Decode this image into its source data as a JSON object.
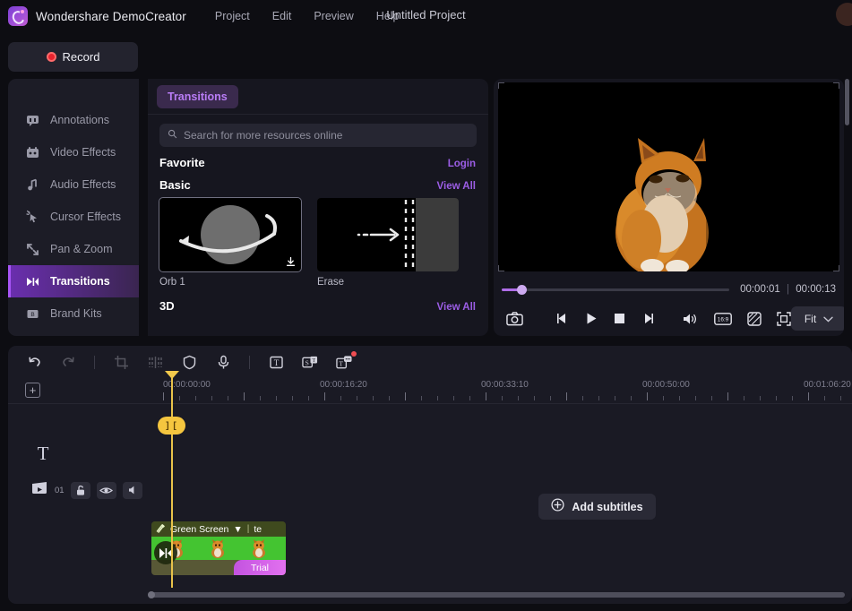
{
  "app": {
    "brand": "Wondershare DemoCreator",
    "project_title": "Untitled Project",
    "menu": [
      "Project",
      "Edit",
      "Preview",
      "Help"
    ],
    "accent": "#a855f7",
    "record_label": "Record"
  },
  "sidebar": {
    "items": [
      {
        "label": "Annotations",
        "icon": "annotations-icon"
      },
      {
        "label": "Video Effects",
        "icon": "video-effects-icon"
      },
      {
        "label": "Audio Effects",
        "icon": "audio-effects-icon"
      },
      {
        "label": "Cursor Effects",
        "icon": "cursor-effects-icon"
      },
      {
        "label": "Pan & Zoom",
        "icon": "pan-zoom-icon"
      },
      {
        "label": "Transitions",
        "icon": "transitions-icon"
      },
      {
        "label": "Brand Kits",
        "icon": "brand-kits-icon"
      }
    ],
    "active": "Transitions"
  },
  "resource_panel": {
    "tab": "Transitions",
    "search_placeholder": "Search for more resources online",
    "sections": [
      {
        "title": "Favorite",
        "link": "Login"
      },
      {
        "title": "Basic",
        "link": "View All"
      },
      {
        "title": "3D",
        "link": "View All"
      }
    ],
    "items": [
      {
        "name": "Orb 1",
        "thumb": "orb-transition-thumb",
        "downloadable": true
      },
      {
        "name": "Erase",
        "thumb": "erase-transition-thumb",
        "downloadable": false
      }
    ]
  },
  "preview": {
    "current_time": "00:00:01",
    "total_time": "00:00:13",
    "separator": "|",
    "progress_percent": 8,
    "fit_label": "Fit",
    "controls": [
      "snapshot-icon",
      "prev-frame-icon",
      "play-icon",
      "stop-icon",
      "next-frame-icon",
      "volume-icon",
      "aspect-ratio-icon",
      "render-icon",
      "fullscreen-icon"
    ],
    "aspect_ratio_label": "16:9"
  },
  "timeline": {
    "toolbar_icons": [
      "undo-icon",
      "redo-icon",
      "crop-icon",
      "split-icon",
      "mask-icon",
      "voiceover-icon",
      "text-icon",
      "sticker-text-icon",
      "caption-icon"
    ],
    "add_track_label": "+",
    "ruler_labels": [
      "00:00:00:00",
      "00:00:16:20",
      "00:00:33:10",
      "00:00:50:00",
      "00:01:06:20"
    ],
    "playhead_badge": "] [",
    "text_track_icon": "text-track-icon",
    "video_track": {
      "number": "01",
      "toggles": [
        "lock-icon",
        "eye-icon",
        "mute-icon"
      ]
    },
    "add_subtitles_label": "Add subtitles",
    "clip": {
      "title": "Green Screen",
      "dropdown": "▼",
      "extra_label": "te",
      "badge": "Trial",
      "transition_icon": "transition-icon"
    }
  }
}
